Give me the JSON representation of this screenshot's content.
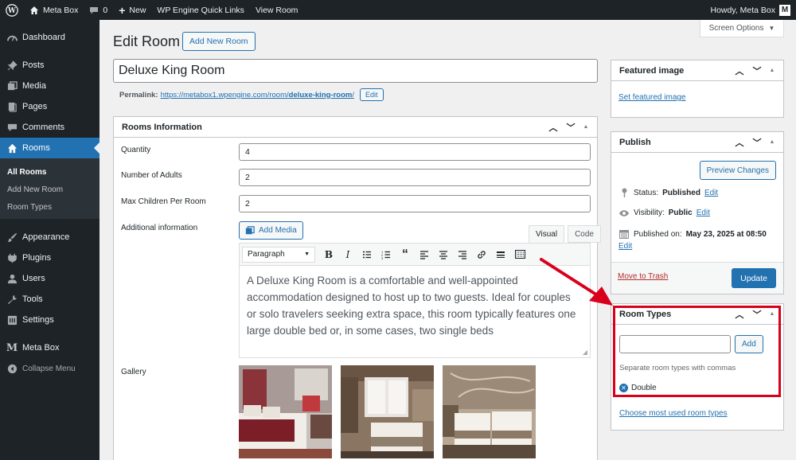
{
  "adminbar": {
    "site_name": "Meta Box",
    "comments_count": "0",
    "new_label": "New",
    "quick_links": "WP Engine Quick Links",
    "view_room": "View Room",
    "howdy": "Howdy, Meta Box",
    "avatar_letter": "M"
  },
  "sidebar": {
    "items": [
      {
        "label": "Dashboard",
        "icon": "dashboard-icon"
      },
      {
        "label": "Posts",
        "icon": "pin-icon"
      },
      {
        "label": "Media",
        "icon": "media-icon"
      },
      {
        "label": "Pages",
        "icon": "pages-icon"
      },
      {
        "label": "Comments",
        "icon": "comment-icon"
      },
      {
        "label": "Rooms",
        "icon": "home-icon"
      }
    ],
    "submenu": [
      "All Rooms",
      "Add New Room",
      "Room Types"
    ],
    "items_after": [
      {
        "label": "Appearance",
        "icon": "brush-icon"
      },
      {
        "label": "Plugins",
        "icon": "plugin-icon"
      },
      {
        "label": "Users",
        "icon": "users-icon"
      },
      {
        "label": "Tools",
        "icon": "wrench-icon"
      },
      {
        "label": "Settings",
        "icon": "settings-icon"
      },
      {
        "label": "Meta Box",
        "icon": "metabox-icon"
      }
    ],
    "collapse": "Collapse Menu"
  },
  "header": {
    "title": "Edit Room",
    "add_new": "Add New Room",
    "screen_options": "Screen Options"
  },
  "post": {
    "title": "Deluxe King Room",
    "permalink_label": "Permalink:",
    "permalink_base": "https://metabox1.wpengine.com/room/",
    "permalink_slug": "deluxe-king-room",
    "permalink_trail": "/",
    "edit_label": "Edit"
  },
  "rooms_box": {
    "title": "Rooms Information",
    "fields": [
      {
        "label": "Quantity",
        "value": "4"
      },
      {
        "label": "Number of Adults",
        "value": "2"
      },
      {
        "label": "Max Children Per Room",
        "value": "2"
      }
    ],
    "additional_label": "Additional information",
    "add_media": "Add Media",
    "tab_visual": "Visual",
    "tab_code": "Code",
    "format": "Paragraph",
    "content": "A Deluxe King Room is a comfortable and well-appointed accommodation designed to host up to two guests. Ideal for couples or solo travelers seeking extra space, this room typically features one large double bed or, in some cases, two single beds",
    "gallery_label": "Gallery"
  },
  "featured": {
    "title": "Featured image",
    "link": "Set featured image"
  },
  "publish": {
    "title": "Publish",
    "preview": "Preview Changes",
    "status_label": "Status:",
    "status_value": "Published",
    "visibility_label": "Visibility:",
    "visibility_value": "Public",
    "published_label": "Published on:",
    "published_value": "May 23, 2025 at 08:50",
    "edit": "Edit",
    "trash": "Move to Trash",
    "update": "Update"
  },
  "room_types": {
    "title": "Room Types",
    "add": "Add",
    "howto": "Separate room types with commas",
    "tags": [
      "Double"
    ],
    "most_used": "Choose most used room types"
  },
  "colors": {
    "accent": "#2271b1",
    "admin_dark": "#1d2327",
    "highlight": "#d9001b"
  }
}
